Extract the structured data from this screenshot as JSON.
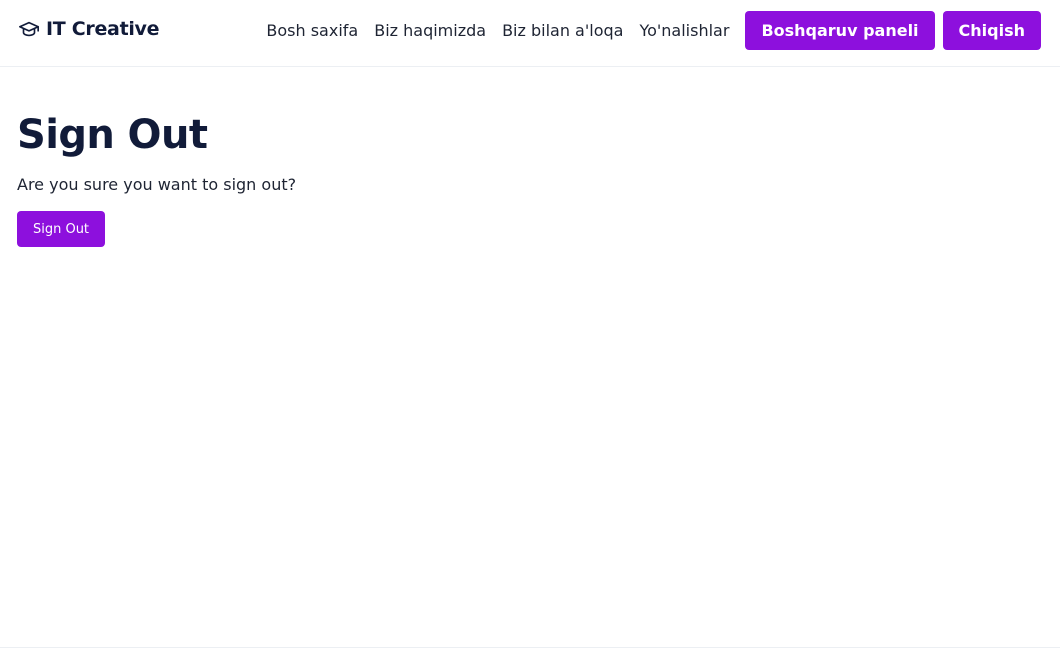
{
  "navbar": {
    "brand": {
      "icon": "graduation-cap-icon",
      "name": "IT Creative"
    },
    "links": [
      {
        "label": "Bosh saxifa"
      },
      {
        "label": "Biz haqimizda"
      },
      {
        "label": "Biz bilan a'loqa"
      },
      {
        "label": "Yo'nalishlar"
      }
    ],
    "dashboard_button": "Boshqaruv paneli",
    "logout_button": "Chiqish"
  },
  "main": {
    "title": "Sign Out",
    "message": "Are you sure you want to sign out?",
    "signout_button": "Sign Out"
  },
  "colors": {
    "accent": "#8d10dd",
    "heading": "#111b39",
    "border": "#eceff3"
  }
}
